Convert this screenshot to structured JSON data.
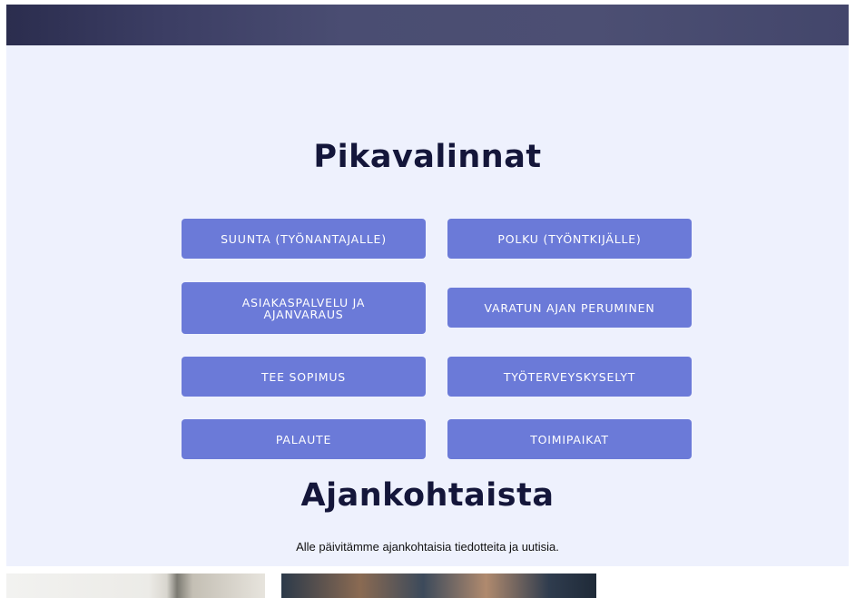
{
  "quick_links": {
    "title": "Pikavalinnat",
    "buttons": [
      {
        "label": "SUUNTA (TYÖNANTAJALLE)"
      },
      {
        "label": "POLKU (TYÖNTKIJÄLLE)"
      },
      {
        "label": "ASIAKASPALVELU JA AJANVARAUS"
      },
      {
        "label": "VARATUN AJAN PERUMINEN"
      },
      {
        "label": "TEE SOPIMUS"
      },
      {
        "label": "TYÖTERVEYSKYSELYT"
      },
      {
        "label": "PALAUTE"
      },
      {
        "label": "TOIMIPAIKAT"
      }
    ]
  },
  "news": {
    "title": "Ajankohtaista",
    "intro": "Alle päivitämme ajankohtaisia tiedotteita ja uutisia."
  },
  "colors": {
    "button_bg": "#6b7ad8",
    "section_bg": "#eef1fd",
    "heading": "#14163a"
  }
}
